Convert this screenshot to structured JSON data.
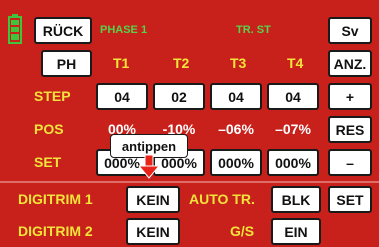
{
  "header": {
    "back_label": "RÜCK",
    "phase_label": "PHASE 1",
    "trst_label": "TR. ST",
    "sv_label": "Sv"
  },
  "columns": {
    "ph_label": "PH",
    "t1": "T1",
    "t2": "T2",
    "t3": "T3",
    "t4": "T4",
    "anz_label": "ANZ."
  },
  "rows": {
    "step": {
      "label": "STEP",
      "values": [
        "04",
        "02",
        "04",
        "04"
      ],
      "action": "+"
    },
    "pos": {
      "label": "POS",
      "values": [
        "00%",
        "-10%",
        "–06%",
        "–07%"
      ],
      "action": "RES"
    },
    "set": {
      "label": "SET",
      "values": [
        "000%",
        "000%",
        "000%",
        "000%"
      ],
      "action": "–"
    }
  },
  "callout": {
    "text": "antippen"
  },
  "digitrim1": {
    "label": "DIGITRIM 1",
    "value": "KEIN",
    "autotr_label": "AUTO TR.",
    "autotr_value": "BLK",
    "set_label": "SET"
  },
  "digitrim2": {
    "label": "DIGITRIM 2",
    "value": "KEIN",
    "gs_label": "G/S",
    "gs_value": "EIN"
  },
  "colors": {
    "background": "#c8211c",
    "yellow": "#f2e43a",
    "green": "#55d34a",
    "battery": "#3fc43b"
  }
}
